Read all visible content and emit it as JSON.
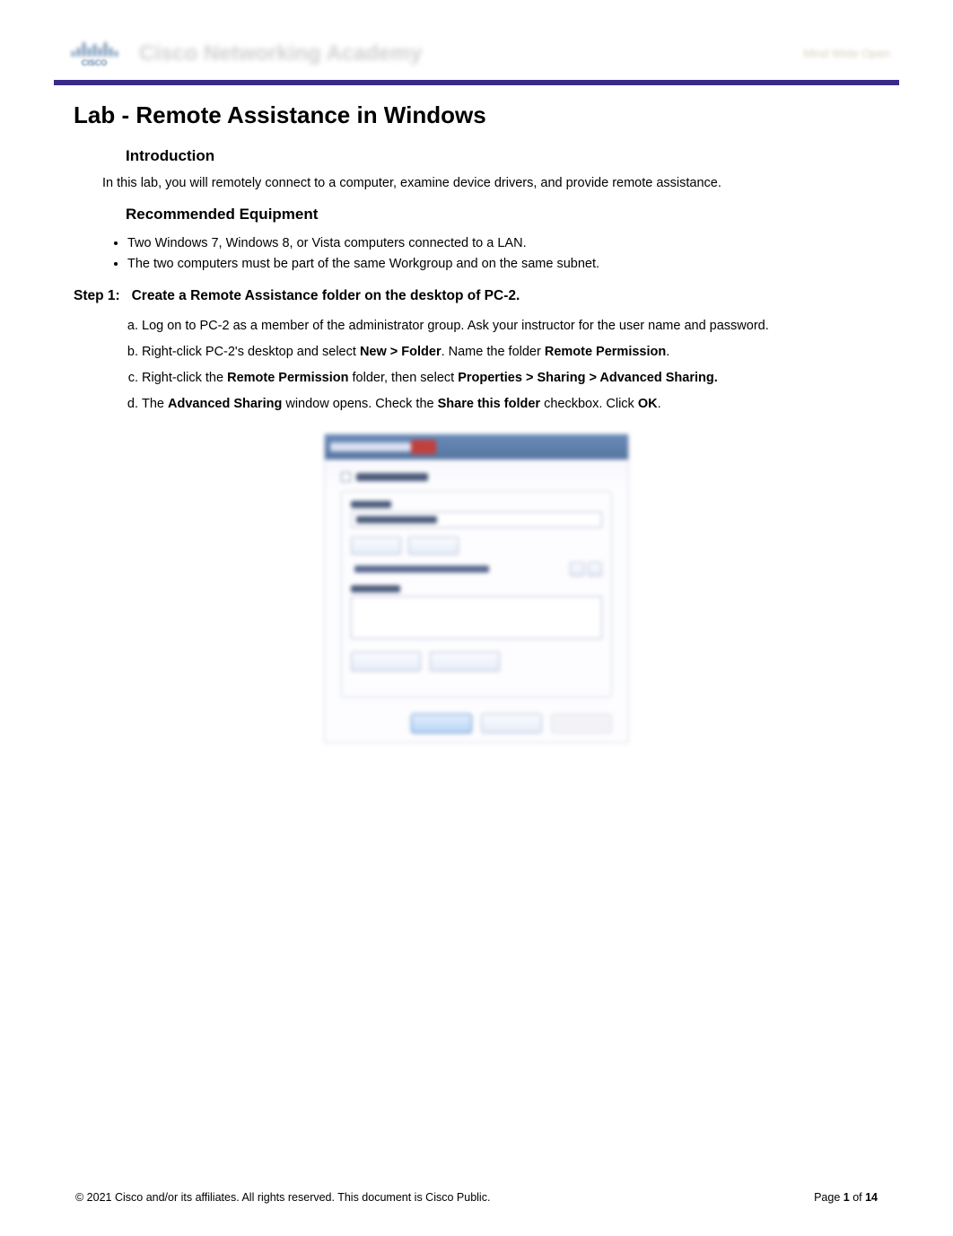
{
  "header": {
    "brand_title": "Cisco Networking Academy",
    "brand_tagline": "Mind Wide Open"
  },
  "title": "Lab - Remote Assistance in Windows",
  "intro": {
    "heading": "Introduction",
    "text": "In this lab, you will remotely connect to a computer, examine device drivers, and provide remote assistance."
  },
  "equipment": {
    "heading": "Recommended Equipment",
    "items": [
      "Two Windows 7, Windows 8, or Vista computers connected to a LAN.",
      "The two computers must be part of the same Workgroup and on the same subnet."
    ]
  },
  "step1": {
    "label_prefix": "Step 1:",
    "label_text": "Create a Remote Assistance folder on the desktop of PC-2.",
    "items": {
      "a": {
        "text": "Log on to PC-2 as a member of the administrator group. Ask your instructor for the user name and password."
      },
      "b": {
        "prefix": "Right-click PC-2's desktop and select ",
        "bold1": "New > Folder",
        "mid": ". Name the folder ",
        "bold2": "Remote Permission",
        "suffix": "."
      },
      "c": {
        "prefix": "Right-click the ",
        "bold1": "Remote Permission",
        "mid": " folder, then select ",
        "bold2": "Properties > Sharing > Advanced Sharing."
      },
      "d": {
        "prefix": "The ",
        "bold1": "Advanced Sharing",
        "mid1": " window opens. Check the ",
        "bold2": "Share this folder",
        "mid2": " checkbox. Click ",
        "bold3": "OK",
        "suffix": "."
      }
    }
  },
  "footer": {
    "copyright": "© 2021 Cisco and/or its affiliates. All rights reserved. This document is Cisco Public.",
    "page_prefix": "Page ",
    "page_current": "1",
    "page_of": " of ",
    "page_total": "14"
  }
}
